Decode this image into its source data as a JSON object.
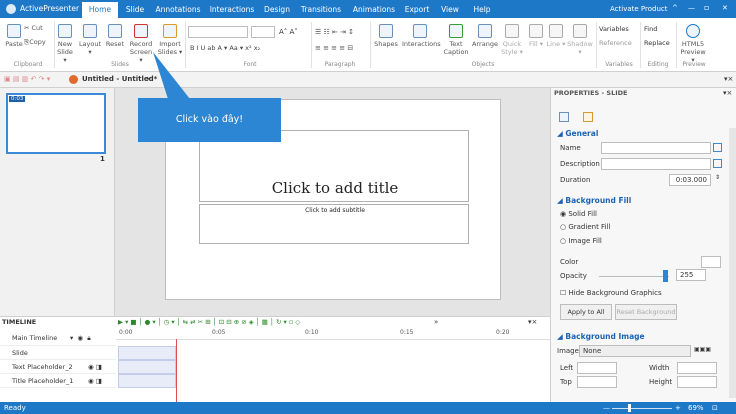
{
  "app": {
    "name": "ActivePresenter",
    "activate": "Activate Product",
    "window_controls": [
      "^",
      "—",
      "▫",
      "✕"
    ]
  },
  "tabs": [
    "Home",
    "Slide",
    "Annotations",
    "Interactions",
    "Design",
    "Transitions",
    "Animations",
    "Export",
    "View",
    "Help"
  ],
  "ribbon": {
    "paste": "Paste",
    "cut": "Cut",
    "copy": "Copy",
    "new_slide": "New Slide ▾",
    "layout": "Layout ▾",
    "reset": "Reset",
    "record_screen": "Record Screen ▾",
    "import_slides": "Import Slides ▾",
    "shapes": "Shapes",
    "interactions": "Interactions",
    "text_caption": "Text Caption",
    "arrange": "Arrange",
    "quick_style": "Quick Style ▾",
    "fill": "Fill ▾",
    "line": "Line ▾",
    "shadow": "Shadow ▾",
    "variables": "Variables",
    "reference": "Reference",
    "find": "Find",
    "replace": "Replace",
    "html5_preview": "HTML5 Preview ▾",
    "font_tools": "B  I  U  ab  A ▾  Aa ▾  x²  x₂",
    "groups": [
      "Clipboard",
      "Slides",
      "Font",
      "Paragraph",
      "Objects",
      "Variables",
      "Editing",
      "Preview"
    ]
  },
  "document": {
    "tab_title": "Untitled - Untitled*",
    "tab_close": "×"
  },
  "slides_panel": {
    "thumb_time": "0:03",
    "slide_number": "1"
  },
  "slide": {
    "title_placeholder": "Click to add title",
    "subtitle_placeholder": "Click to add subtitle"
  },
  "tooltip": "Click vào đây!",
  "properties": {
    "header": "PROPERTIES - SLIDE",
    "general": "General",
    "name_label": "Name",
    "description_label": "Description",
    "duration_label": "Duration",
    "duration_value": "0:03.000",
    "background_fill": "Background Fill",
    "solid_fill": "Solid Fill",
    "gradient_fill": "Gradient Fill",
    "image_fill": "Image Fill",
    "color_label": "Color",
    "opacity_label": "Opacity",
    "opacity_value": "255",
    "hide_bg": "Hide Background Graphics",
    "apply_all": "Apply to All",
    "reset_bg": "Reset Background",
    "background_image": "Background Image",
    "image_label": "Image",
    "image_value": "None",
    "left_label": "Left",
    "width_label": "Width",
    "top_label": "Top",
    "height_label": "Height"
  },
  "timeline": {
    "label": "TIMELINE",
    "rows": [
      "Main Timeline",
      "Slide",
      "Text Placeholder_2",
      "Title Placeholder_1"
    ],
    "ticks": [
      "0:00",
      "0:05",
      "0:10",
      "0:15",
      "0:20"
    ],
    "zoom": "»"
  },
  "status": {
    "left": "Ready",
    "zoom": "69%"
  }
}
